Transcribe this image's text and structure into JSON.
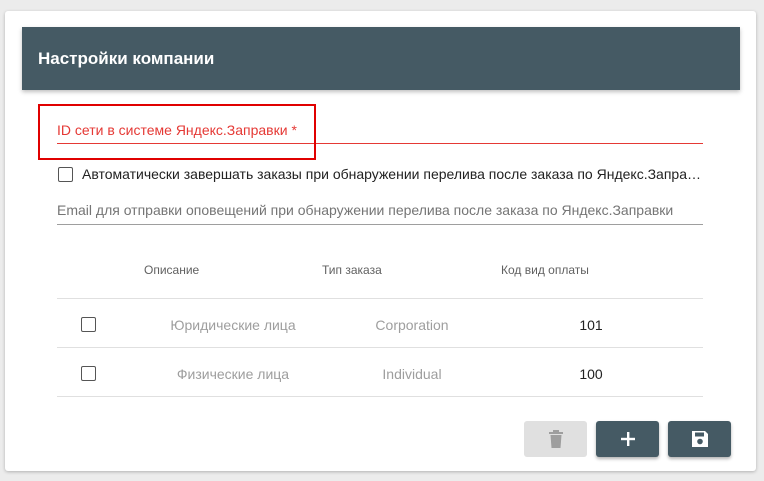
{
  "header": {
    "title": "Настройки компании"
  },
  "form": {
    "network_id_label": "ID сети в системе Яндекс.Заправки *",
    "auto_complete_label": "Автоматически завершать заказы при обнаружении перелива после заказа по Яндекс.Заправки",
    "email_placeholder": "Email для отправки оповещений при обнаружении перелива после заказа по Яндекс.Заправки"
  },
  "table": {
    "headers": {
      "description": "Описание",
      "order_type": "Тип заказа",
      "payment_code": "Код вид оплаты"
    },
    "rows": [
      {
        "description": "Юридические лица",
        "order_type": "Corporation",
        "payment_code": "101"
      },
      {
        "description": "Физические лица",
        "order_type": "Individual",
        "payment_code": "100"
      }
    ]
  },
  "actions": {
    "delete_icon": "trash-icon",
    "add_icon": "plus-icon",
    "save_icon": "floppy-disk-icon"
  },
  "colors": {
    "header_bg": "#455a64",
    "error_red": "#e53935",
    "highlight": "#e00000",
    "disabled_button": "#e0e0e0"
  }
}
